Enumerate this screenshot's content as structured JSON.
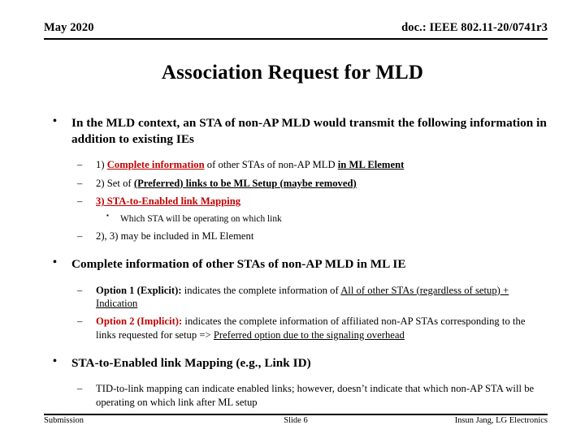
{
  "header": {
    "date": "May 2020",
    "doc": "doc.: IEEE 802.11-20/0741r3"
  },
  "title": "Association Request for MLD",
  "content": {
    "bullet1": {
      "marker": "•",
      "text": "In the MLD context, an STA of non-AP MLD would transmit the following information in addition to existing IEs",
      "sub": [
        {
          "marker": "–",
          "num": "1)",
          "part_red_bold_u": "Complete information",
          "part_plain": " of other STAs of non-AP MLD ",
          "part_black_bold_u": "in ML Element"
        },
        {
          "marker": "–",
          "num": "2)",
          "part_plain": " Set of ",
          "part_black_bold_u": "(Preferred) links to be ML Setup (maybe removed)"
        },
        {
          "marker": "–",
          "all_red_bold_u": "3) STA-to-Enabled link Mapping"
        }
      ],
      "subsub": {
        "marker": "▪",
        "text": "Which STA will be operating on which link"
      },
      "sub_last": {
        "marker": "–",
        "text": "2), 3) may be included in ML Element"
      }
    },
    "bullet2": {
      "marker": "•",
      "text": "Complete information of other STAs of non-AP MLD in ML IE",
      "sub": [
        {
          "marker": "–",
          "label": "Option 1 (Explicit):",
          "label_color": "black",
          "body_plain": " indicates the complete information of ",
          "body_underlined": "All of other STAs (regardless of setup) + Indication"
        },
        {
          "marker": "–",
          "label": "Option 2 (Implicit):",
          "label_color": "red",
          "body_plain": " indicates the complete information of affiliated non-AP STAs corresponding to the links requested for setup  => ",
          "body_underlined": "Preferred option due to the signaling overhead"
        }
      ]
    },
    "bullet3": {
      "marker": "•",
      "text": "STA-to-Enabled link Mapping (e.g., Link ID)",
      "sub": [
        {
          "marker": "–",
          "text": "TID-to-link mapping can indicate enabled links; however, doesn’t indicate that which non-AP STA will be operating on which link after ML setup"
        }
      ]
    }
  },
  "footer": {
    "left": "Submission",
    "center": "Slide 6",
    "right": "Insun Jang, LG Electronics"
  },
  "colors": {
    "accent_red": "#C00000",
    "text": "#000000",
    "background": "#FFFFFF"
  }
}
